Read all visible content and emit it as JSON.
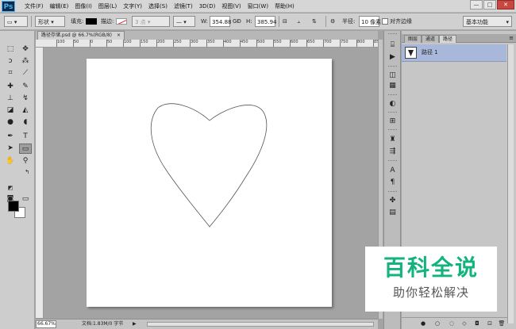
{
  "app": {
    "logo": "Ps"
  },
  "menu": [
    "文件(F)",
    "编辑(E)",
    "图像(I)",
    "图层(L)",
    "文字(Y)",
    "选择(S)",
    "滤镜(T)",
    "3D(D)",
    "视图(V)",
    "窗口(W)",
    "帮助(H)"
  ],
  "window_controls": {
    "minimize": "—",
    "restore": "□",
    "close": "✕"
  },
  "options": {
    "tool_mode": "形状",
    "fill_label": "填充:",
    "stroke_label": "描边:",
    "stroke_width": "3 点",
    "w_label": "W:",
    "w_value": "354.88",
    "link": "GĐ",
    "h_label": "H:",
    "h_value": "385.94",
    "radius_label": "半径:",
    "radius_value": "10 像素",
    "align_edges": "对齐边缘",
    "workspace": "基本功能"
  },
  "document": {
    "tab_title": "路径存储.psd @ 66.7%(RGB/8)",
    "tab_close": "×",
    "ruler_ticks": [
      "100",
      "50",
      "0",
      "50",
      "100",
      "150",
      "200",
      "250",
      "300",
      "350",
      "400",
      "450",
      "500",
      "550",
      "600",
      "650",
      "700",
      "750",
      "800",
      "850"
    ]
  },
  "status": {
    "zoom": "66.67%",
    "doc_size": "文档:1.83M/0 字节",
    "arrow": "▶"
  },
  "paths_panel": {
    "tabs": [
      "图层",
      "通道",
      "路径"
    ],
    "menu": "≡",
    "items": [
      {
        "name": "路径 1"
      }
    ]
  },
  "watermark": {
    "title": "百科全说",
    "subtitle": "助你轻松解决"
  },
  "colors": {
    "watermark_green": "#12b37c",
    "selected_path_row": "#a9b8da",
    "close_button": "#c9473f"
  }
}
